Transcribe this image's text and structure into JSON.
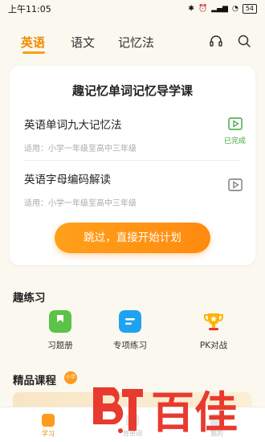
{
  "status_bar": {
    "time": "上午11:05",
    "battery": "54"
  },
  "top_tabs": [
    {
      "label": "英语",
      "active": true
    },
    {
      "label": "语文",
      "active": false
    },
    {
      "label": "记忆法",
      "active": false
    }
  ],
  "icons": {
    "headset": "headset-icon",
    "search": "search-icon"
  },
  "guide_card": {
    "title": "趣记忆单词记忆导学课",
    "lessons": [
      {
        "title": "英语单词九大记忆法",
        "subtitle": "适用：小学一年级至高中三年级",
        "status": "已完成"
      },
      {
        "title": "英语字母编码解读",
        "subtitle": "适用：小学一年级至高中三年级",
        "status": ""
      }
    ],
    "cta": "跳过，直接开始计划"
  },
  "practice": {
    "title": "趣练习",
    "items": [
      {
        "label": "习题册",
        "icon": "workbook-icon",
        "color": "#5cc24a"
      },
      {
        "label": "专项练习",
        "icon": "special-practice-icon",
        "color": "#1fa3f0"
      },
      {
        "label": "PK对战",
        "icon": "trophy-icon",
        "color": "#ffb400"
      }
    ]
  },
  "courses": {
    "title": "精品课程",
    "badge": "小学"
  },
  "bottom_nav": [
    {
      "label": "学习",
      "active": true
    },
    {
      "label": "背单词",
      "active": false
    },
    {
      "label": "我的",
      "active": false
    }
  ],
  "watermark": "百佳",
  "colors": {
    "accent": "#f08a00",
    "done": "#3fa63f",
    "background": "#fbf8f0"
  }
}
